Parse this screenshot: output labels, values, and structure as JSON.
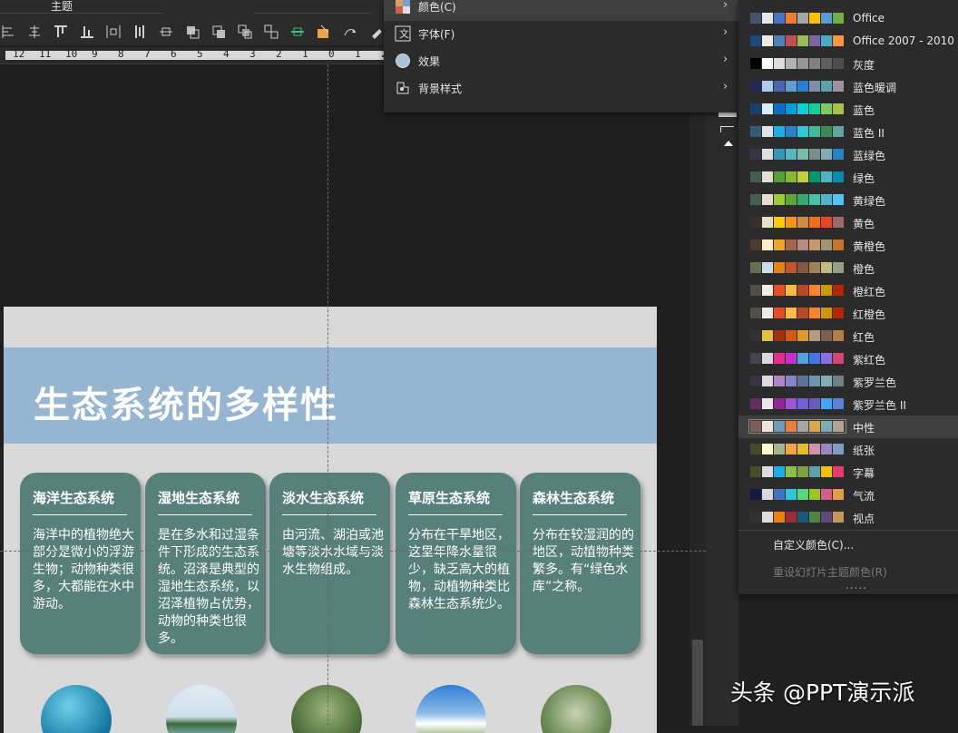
{
  "toolbar": {
    "theme_label": "主题",
    "icons": [
      "align-left-icon",
      "align-center-icon",
      "align-top-icon",
      "align-bottom-icon",
      "distribute-horizontal-icon",
      "distribute-vertical-icon",
      "align-middle-icon",
      "bring-forward-icon",
      "send-backward-icon",
      "bring-to-front-icon",
      "send-to-back-icon",
      "group-icon",
      "selection-pane-icon",
      "rotate-icon",
      "format-painter-icon"
    ]
  },
  "ruler": {
    "labels": [
      "12",
      "11",
      "10",
      "9",
      "8",
      "7",
      "6",
      "5",
      "4",
      "3",
      "2",
      "1",
      "0",
      "1",
      "2"
    ]
  },
  "slide": {
    "title": "生态系统的多样性",
    "cards": [
      {
        "title": "海洋生态系统",
        "body": "海洋中的植物绝大部分是微小的浮游生物；动物种类很多，大都能在水中游动。"
      },
      {
        "title": "湿地生态系统",
        "body": "是在多水和过湿条件下形成的生态系统。沼泽是典型的湿地生态系统，以沼泽植物占优势，动物的种类也很多。"
      },
      {
        "title": "淡水生态系统",
        "body": "由河流、湖泊或池塘等淡水水域与淡水生物组成。"
      },
      {
        "title": "草原生态系统",
        "body": "分布在干旱地区，这里年降水量很少，缺乏高大的植物，动植物种类比森林生态系统少。"
      },
      {
        "title": "森林生态系统",
        "body": "分布在较湿润的的地区，动植物种类繁多。有“绿色水库”之称。"
      }
    ],
    "photos": [
      "ocean-photo",
      "wetland-photo",
      "freshwater-photo",
      "grassland-photo",
      "forest-photo"
    ]
  },
  "variant_menu": {
    "items": [
      {
        "label": "颜色(C)",
        "icon": "colors-icon"
      },
      {
        "label": "字体(F)",
        "icon": "fonts-icon"
      },
      {
        "label": "效果",
        "icon": "effects-icon"
      },
      {
        "label": "背景样式",
        "icon": "background-style-icon"
      }
    ]
  },
  "color_menu": {
    "schemes": [
      {
        "name": "Office",
        "colors": [
          "#44546a",
          "#e7e6e6",
          "#4472c4",
          "#ed7d31",
          "#a5a5a5",
          "#ffc000",
          "#5b9bd5",
          "#70ad47"
        ]
      },
      {
        "name": "Office 2007 - 2010",
        "colors": [
          "#1f497d",
          "#eeece1",
          "#4f81bd",
          "#c0504d",
          "#9bbb59",
          "#8064a2",
          "#4bacc6",
          "#f79646"
        ]
      },
      {
        "name": "灰度",
        "colors": [
          "#000000",
          "#f8f8f8",
          "#dddddd",
          "#b2b2b2",
          "#969696",
          "#808080",
          "#5f5f5f",
          "#4d4d4d"
        ]
      },
      {
        "name": "蓝色暖调",
        "colors": [
          "#242852",
          "#acccea",
          "#4a66ac",
          "#629dd1",
          "#297fd5",
          "#7f8fa9",
          "#5aa2ae",
          "#9d90a0"
        ]
      },
      {
        "name": "蓝色",
        "colors": [
          "#17406d",
          "#dbeff9",
          "#0f6fc6",
          "#009dd9",
          "#0bd0d9",
          "#10cf9b",
          "#7cca62",
          "#a5c249"
        ]
      },
      {
        "name": "蓝色 II",
        "colors": [
          "#335b74",
          "#dfe3e5",
          "#1cade4",
          "#2683c6",
          "#27ced7",
          "#42ba97",
          "#3e8853",
          "#62a39f"
        ]
      },
      {
        "name": "蓝绿色",
        "colors": [
          "#373545",
          "#dedede",
          "#3494ba",
          "#58b6c0",
          "#75bda7",
          "#7a8c8e",
          "#84acb6",
          "#2683c6"
        ]
      },
      {
        "name": "绿色",
        "colors": [
          "#455f51",
          "#e3ded1",
          "#549e39",
          "#8ab833",
          "#c0cf3a",
          "#029676",
          "#4ab5c4",
          "#0989b1"
        ]
      },
      {
        "name": "黄绿色",
        "colors": [
          "#455f51",
          "#e3ded1",
          "#99cb38",
          "#63a537",
          "#37a76f",
          "#44c1a3",
          "#4eb3cf",
          "#51c3f9"
        ]
      },
      {
        "name": "黄色",
        "colors": [
          "#39302a",
          "#e5dec9",
          "#ffca08",
          "#f8931d",
          "#ce8d3e",
          "#ec7016",
          "#e64823",
          "#9c6a6a"
        ]
      },
      {
        "name": "黄橙色",
        "colors": [
          "#4e3b30",
          "#fbeec9",
          "#f0a22e",
          "#a5644e",
          "#b58b80",
          "#c3986d",
          "#a19574",
          "#c17529"
        ]
      },
      {
        "name": "橙色",
        "colors": [
          "#637052",
          "#ccddea",
          "#e48312",
          "#bd582c",
          "#865640",
          "#9b8357",
          "#c2bc80",
          "#94a088"
        ]
      },
      {
        "name": "橙红色",
        "colors": [
          "#505046",
          "#eeece1",
          "#e84c22",
          "#ffbd47",
          "#b64926",
          "#ff8427",
          "#cc9900",
          "#b22600"
        ]
      },
      {
        "name": "红橙色",
        "colors": [
          "#505046",
          "#eeece1",
          "#e84c22",
          "#ffbd47",
          "#b64926",
          "#ff8427",
          "#cc9900",
          "#b22600"
        ]
      },
      {
        "name": "红色",
        "colors": [
          "#323232",
          "#e5c243",
          "#a5300f",
          "#d55816",
          "#e19825",
          "#b19c7d",
          "#7f5f52",
          "#b27d49"
        ]
      },
      {
        "name": "紫红色",
        "colors": [
          "#454551",
          "#d8d9dc",
          "#e32d91",
          "#c830cc",
          "#4ea6dc",
          "#4775e7",
          "#8971e1",
          "#d54773"
        ]
      },
      {
        "name": "紫罗兰色",
        "colors": [
          "#373545",
          "#dcd8dc",
          "#ad84c6",
          "#8784c7",
          "#5d739a",
          "#6997af",
          "#84acb6",
          "#6f8183"
        ]
      },
      {
        "name": "紫罗兰色 II",
        "colors": [
          "#632e62",
          "#eae5eb",
          "#92278f",
          "#9b57d3",
          "#755dd9",
          "#665eb8",
          "#45a5ed",
          "#5982db"
        ]
      },
      {
        "name": "中性",
        "colors": [
          "#7c5f5b",
          "#efe4da",
          "#6f9bb7",
          "#e57f42",
          "#a5a5a5",
          "#d4a84e",
          "#7cadb1",
          "#b0a395"
        ]
      },
      {
        "name": "纸张",
        "colors": [
          "#444d26",
          "#fefac9",
          "#a5b592",
          "#f3a447",
          "#e7bc29",
          "#d092a7",
          "#9c85c0",
          "#809ec2"
        ]
      },
      {
        "name": "字幕",
        "colors": [
          "#444d26",
          "#dddddd",
          "#1cade4",
          "#8cc04b",
          "#7da13b",
          "#5aa2ae",
          "#f5c201",
          "#e33d6f"
        ]
      },
      {
        "name": "气流",
        "colors": [
          "#0f1b40",
          "#d8d9dc",
          "#4472c4",
          "#33c5dc",
          "#56d87a",
          "#98c723",
          "#d65d86",
          "#e49d47"
        ]
      },
      {
        "name": "视点",
        "colors": [
          "#323232",
          "#dcdcdc",
          "#f07f09",
          "#9f2936",
          "#1b587c",
          "#4e8542",
          "#604878",
          "#c19859"
        ]
      }
    ],
    "selected": "中性",
    "custom_label": "自定义颜色(C)...",
    "reset_label": "重设幻灯片主题颜色(R)",
    "more": "....."
  },
  "watermark": "头条 @PPT演示派"
}
